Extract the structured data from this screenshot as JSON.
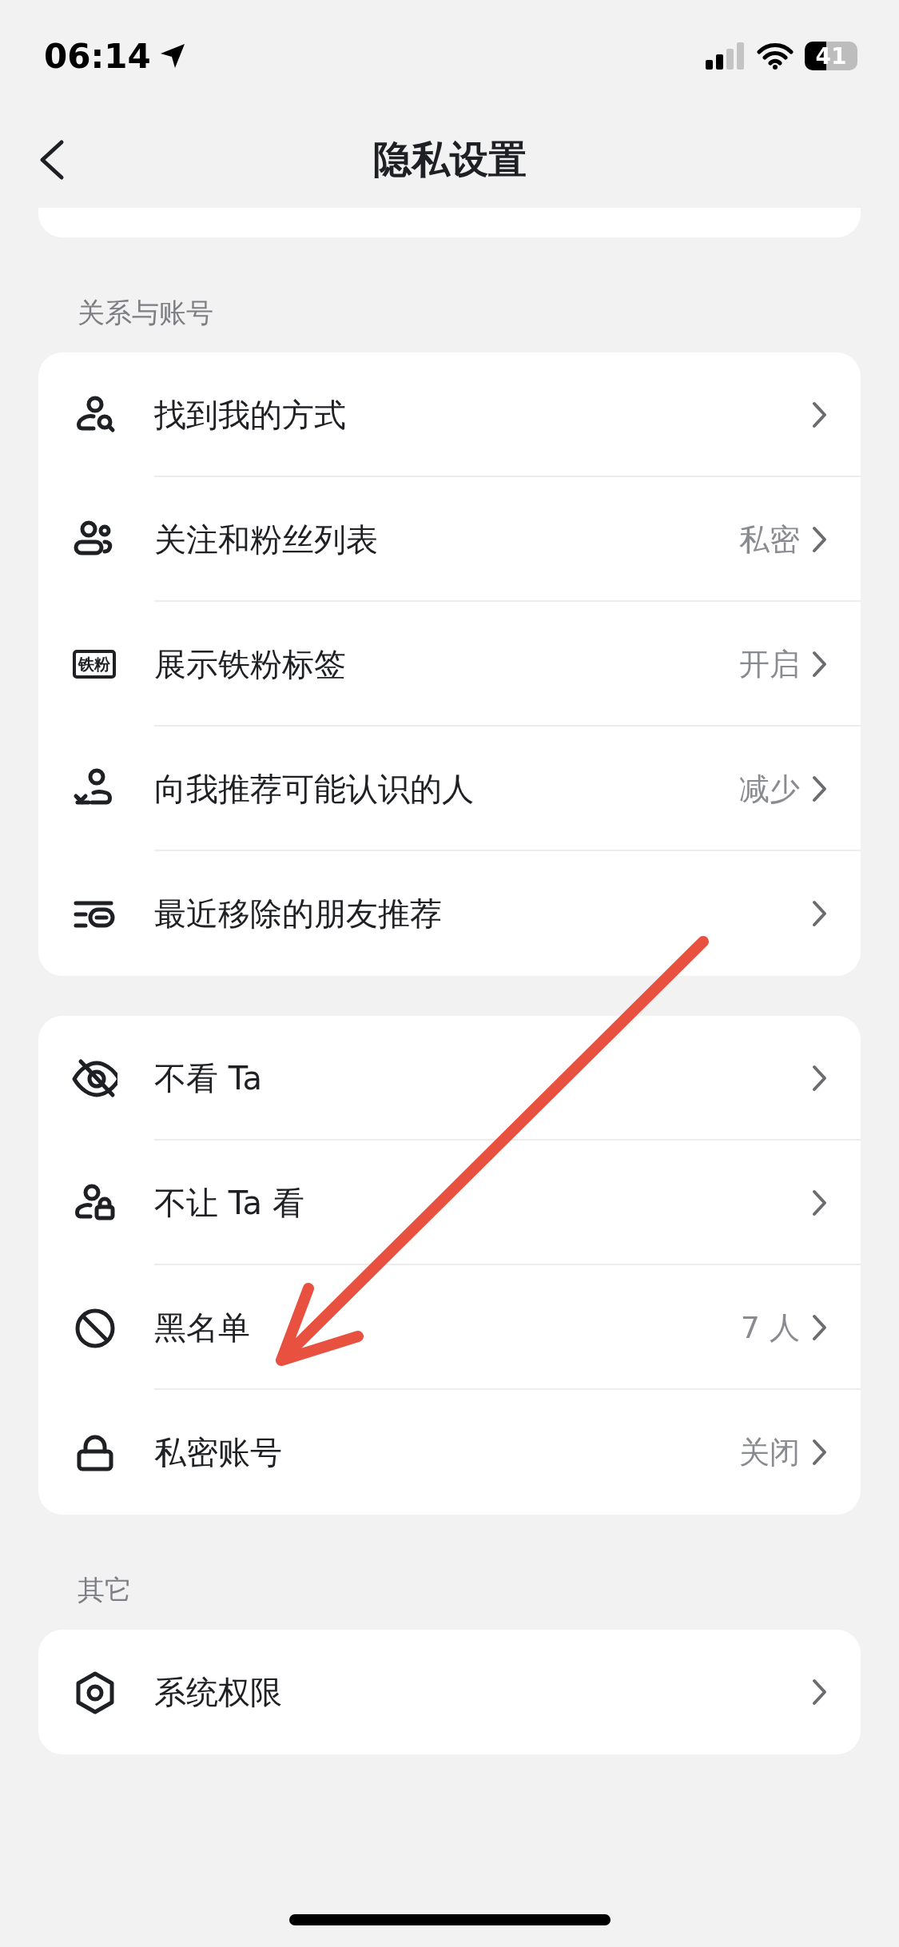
{
  "status_bar": {
    "time": "06:14",
    "battery": "41"
  },
  "nav": {
    "title": "隐私设置"
  },
  "sections": [
    {
      "header": "关系与账号",
      "rows": [
        {
          "label": "找到我的方式"
        },
        {
          "label": "关注和粉丝列表",
          "value": "私密"
        },
        {
          "label": "展示铁粉标签",
          "value": "开启",
          "tag": "铁粉"
        },
        {
          "label": "向我推荐可能认识的人",
          "value": "减少"
        },
        {
          "label": "最近移除的朋友推荐"
        }
      ]
    },
    {
      "rows": [
        {
          "label": "不看 Ta"
        },
        {
          "label": "不让 Ta 看"
        },
        {
          "label": "黑名单",
          "value": "7 人"
        },
        {
          "label": "私密账号",
          "value": "关闭"
        }
      ]
    },
    {
      "header": "其它",
      "rows": [
        {
          "label": "系统权限"
        }
      ]
    }
  ]
}
